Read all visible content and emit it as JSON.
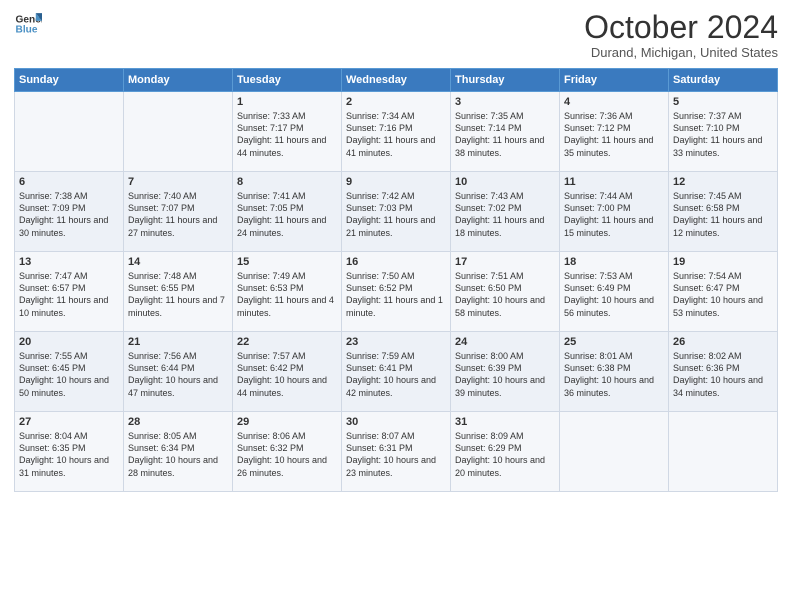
{
  "logo": {
    "line1": "General",
    "line2": "Blue"
  },
  "title": "October 2024",
  "subtitle": "Durand, Michigan, United States",
  "days_of_week": [
    "Sunday",
    "Monday",
    "Tuesday",
    "Wednesday",
    "Thursday",
    "Friday",
    "Saturday"
  ],
  "weeks": [
    [
      {
        "day": "",
        "content": ""
      },
      {
        "day": "",
        "content": ""
      },
      {
        "day": "1",
        "sunrise": "Sunrise: 7:33 AM",
        "sunset": "Sunset: 7:17 PM",
        "daylight": "Daylight: 11 hours and 44 minutes."
      },
      {
        "day": "2",
        "sunrise": "Sunrise: 7:34 AM",
        "sunset": "Sunset: 7:16 PM",
        "daylight": "Daylight: 11 hours and 41 minutes."
      },
      {
        "day": "3",
        "sunrise": "Sunrise: 7:35 AM",
        "sunset": "Sunset: 7:14 PM",
        "daylight": "Daylight: 11 hours and 38 minutes."
      },
      {
        "day": "4",
        "sunrise": "Sunrise: 7:36 AM",
        "sunset": "Sunset: 7:12 PM",
        "daylight": "Daylight: 11 hours and 35 minutes."
      },
      {
        "day": "5",
        "sunrise": "Sunrise: 7:37 AM",
        "sunset": "Sunset: 7:10 PM",
        "daylight": "Daylight: 11 hours and 33 minutes."
      }
    ],
    [
      {
        "day": "6",
        "sunrise": "Sunrise: 7:38 AM",
        "sunset": "Sunset: 7:09 PM",
        "daylight": "Daylight: 11 hours and 30 minutes."
      },
      {
        "day": "7",
        "sunrise": "Sunrise: 7:40 AM",
        "sunset": "Sunset: 7:07 PM",
        "daylight": "Daylight: 11 hours and 27 minutes."
      },
      {
        "day": "8",
        "sunrise": "Sunrise: 7:41 AM",
        "sunset": "Sunset: 7:05 PM",
        "daylight": "Daylight: 11 hours and 24 minutes."
      },
      {
        "day": "9",
        "sunrise": "Sunrise: 7:42 AM",
        "sunset": "Sunset: 7:03 PM",
        "daylight": "Daylight: 11 hours and 21 minutes."
      },
      {
        "day": "10",
        "sunrise": "Sunrise: 7:43 AM",
        "sunset": "Sunset: 7:02 PM",
        "daylight": "Daylight: 11 hours and 18 minutes."
      },
      {
        "day": "11",
        "sunrise": "Sunrise: 7:44 AM",
        "sunset": "Sunset: 7:00 PM",
        "daylight": "Daylight: 11 hours and 15 minutes."
      },
      {
        "day": "12",
        "sunrise": "Sunrise: 7:45 AM",
        "sunset": "Sunset: 6:58 PM",
        "daylight": "Daylight: 11 hours and 12 minutes."
      }
    ],
    [
      {
        "day": "13",
        "sunrise": "Sunrise: 7:47 AM",
        "sunset": "Sunset: 6:57 PM",
        "daylight": "Daylight: 11 hours and 10 minutes."
      },
      {
        "day": "14",
        "sunrise": "Sunrise: 7:48 AM",
        "sunset": "Sunset: 6:55 PM",
        "daylight": "Daylight: 11 hours and 7 minutes."
      },
      {
        "day": "15",
        "sunrise": "Sunrise: 7:49 AM",
        "sunset": "Sunset: 6:53 PM",
        "daylight": "Daylight: 11 hours and 4 minutes."
      },
      {
        "day": "16",
        "sunrise": "Sunrise: 7:50 AM",
        "sunset": "Sunset: 6:52 PM",
        "daylight": "Daylight: 11 hours and 1 minute."
      },
      {
        "day": "17",
        "sunrise": "Sunrise: 7:51 AM",
        "sunset": "Sunset: 6:50 PM",
        "daylight": "Daylight: 10 hours and 58 minutes."
      },
      {
        "day": "18",
        "sunrise": "Sunrise: 7:53 AM",
        "sunset": "Sunset: 6:49 PM",
        "daylight": "Daylight: 10 hours and 56 minutes."
      },
      {
        "day": "19",
        "sunrise": "Sunrise: 7:54 AM",
        "sunset": "Sunset: 6:47 PM",
        "daylight": "Daylight: 10 hours and 53 minutes."
      }
    ],
    [
      {
        "day": "20",
        "sunrise": "Sunrise: 7:55 AM",
        "sunset": "Sunset: 6:45 PM",
        "daylight": "Daylight: 10 hours and 50 minutes."
      },
      {
        "day": "21",
        "sunrise": "Sunrise: 7:56 AM",
        "sunset": "Sunset: 6:44 PM",
        "daylight": "Daylight: 10 hours and 47 minutes."
      },
      {
        "day": "22",
        "sunrise": "Sunrise: 7:57 AM",
        "sunset": "Sunset: 6:42 PM",
        "daylight": "Daylight: 10 hours and 44 minutes."
      },
      {
        "day": "23",
        "sunrise": "Sunrise: 7:59 AM",
        "sunset": "Sunset: 6:41 PM",
        "daylight": "Daylight: 10 hours and 42 minutes."
      },
      {
        "day": "24",
        "sunrise": "Sunrise: 8:00 AM",
        "sunset": "Sunset: 6:39 PM",
        "daylight": "Daylight: 10 hours and 39 minutes."
      },
      {
        "day": "25",
        "sunrise": "Sunrise: 8:01 AM",
        "sunset": "Sunset: 6:38 PM",
        "daylight": "Daylight: 10 hours and 36 minutes."
      },
      {
        "day": "26",
        "sunrise": "Sunrise: 8:02 AM",
        "sunset": "Sunset: 6:36 PM",
        "daylight": "Daylight: 10 hours and 34 minutes."
      }
    ],
    [
      {
        "day": "27",
        "sunrise": "Sunrise: 8:04 AM",
        "sunset": "Sunset: 6:35 PM",
        "daylight": "Daylight: 10 hours and 31 minutes."
      },
      {
        "day": "28",
        "sunrise": "Sunrise: 8:05 AM",
        "sunset": "Sunset: 6:34 PM",
        "daylight": "Daylight: 10 hours and 28 minutes."
      },
      {
        "day": "29",
        "sunrise": "Sunrise: 8:06 AM",
        "sunset": "Sunset: 6:32 PM",
        "daylight": "Daylight: 10 hours and 26 minutes."
      },
      {
        "day": "30",
        "sunrise": "Sunrise: 8:07 AM",
        "sunset": "Sunset: 6:31 PM",
        "daylight": "Daylight: 10 hours and 23 minutes."
      },
      {
        "day": "31",
        "sunrise": "Sunrise: 8:09 AM",
        "sunset": "Sunset: 6:29 PM",
        "daylight": "Daylight: 10 hours and 20 minutes."
      },
      {
        "day": "",
        "content": ""
      },
      {
        "day": "",
        "content": ""
      }
    ]
  ]
}
